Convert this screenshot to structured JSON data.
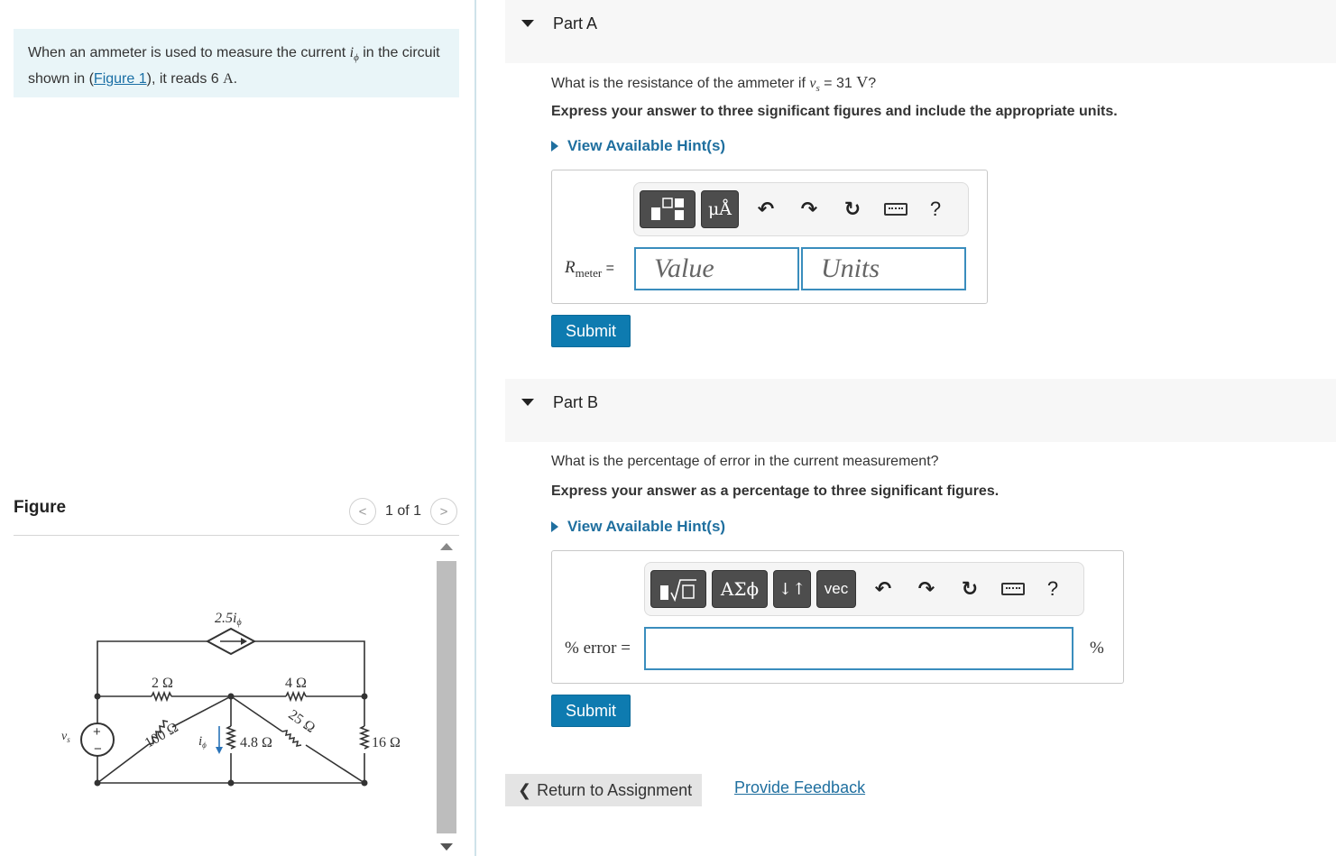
{
  "intro": {
    "text_before": "When an ammeter is used to measure the current ",
    "current_sym": "i",
    "current_sub": "ϕ",
    "text_middle": " in the circuit shown in (",
    "figure_link": "Figure 1",
    "text_after": "), it reads 6 ",
    "unit": "A",
    "period": "."
  },
  "figure": {
    "title": "Figure",
    "pager_text": "1 of 1",
    "prev": "<",
    "next": ">",
    "labels": {
      "dep_source": "2.5i",
      "dep_sub": "ϕ",
      "r1": "2 Ω",
      "r2": "4 Ω",
      "r3": "100 Ω",
      "r4": "25 Ω",
      "r5": "4.8 Ω",
      "r6": "16 Ω",
      "vs": "v",
      "vs_sub": "s",
      "iphi": "i",
      "iphi_sub": "ϕ",
      "plus": "+",
      "minus": "−"
    }
  },
  "partA": {
    "label": "Part A",
    "question_before": "What is the resistance of the ammeter if ",
    "question_var": "v",
    "question_sub": "s",
    "question_after": " = 31 ",
    "question_unit": "V",
    "question_end": "?",
    "instruction": "Express your answer to three significant figures and include the appropriate units.",
    "hint": "View Available Hint(s)",
    "toolbar": {
      "template_btn": "▪▫",
      "units_btn": "μÅ",
      "undo": "↶",
      "redo": "↷",
      "reset": "↻",
      "help": "?"
    },
    "input_label_var": "R",
    "input_label_sub": "meter",
    "input_label_eq": " =",
    "value_placeholder": "Value",
    "units_placeholder": "Units",
    "submit": "Submit"
  },
  "partB": {
    "label": "Part B",
    "question": "What is the percentage of error in the current measurement?",
    "instruction": "Express your answer as a percentage to three significant figures.",
    "hint": "View Available Hint(s)",
    "toolbar": {
      "template_btn": "▪√▫",
      "greek_btn": "ΑΣϕ",
      "arrows_btn": "↓↑",
      "vec_btn": "vec",
      "undo": "↶",
      "redo": "↷",
      "reset": "↻",
      "help": "?"
    },
    "input_label": "% error =",
    "unit_suffix": "%",
    "submit": "Submit"
  },
  "footer": {
    "return": "Return to Assignment",
    "feedback": "Provide Feedback"
  }
}
